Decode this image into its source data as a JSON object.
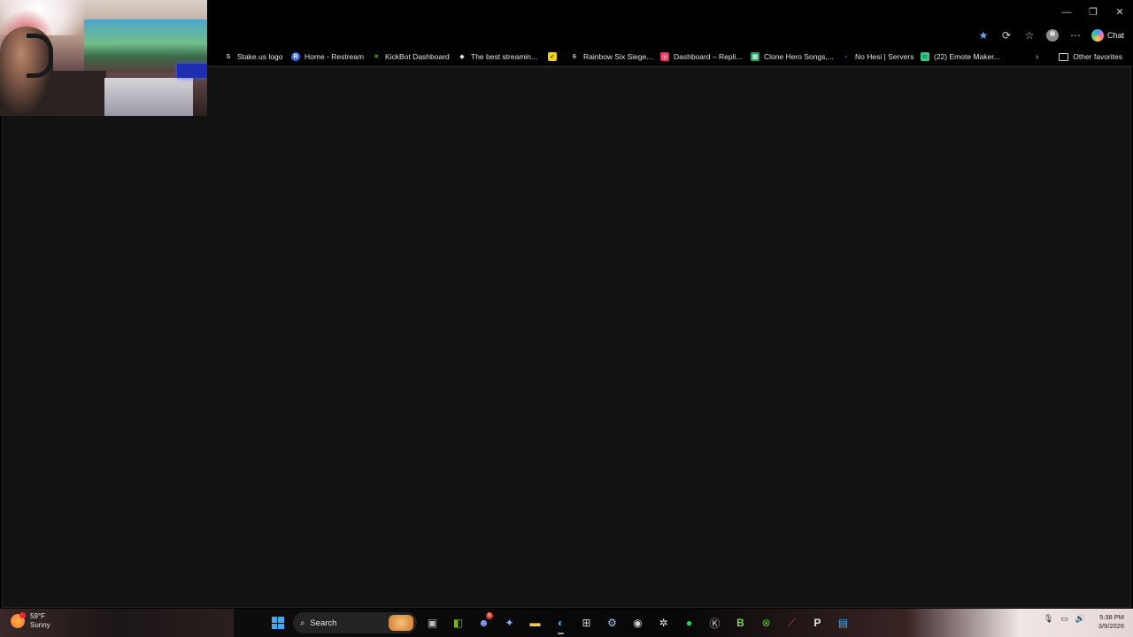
{
  "window": {
    "controls": {
      "minimize": "—",
      "restore": "❐",
      "close": "✕"
    }
  },
  "toolbar": {
    "favorite_star_icon": "star-icon",
    "extensions_icon": "extensions-icon",
    "favorites_icon": "favorites-icon",
    "profile_icon": "profile-icon",
    "more_icon": "more-icon",
    "chat_label": "Chat"
  },
  "favorites_bar": {
    "items": [
      {
        "label": "Stake.us logo",
        "icon": "S",
        "color": "#cfcfcf"
      },
      {
        "label": "Home - Restream",
        "icon": "R",
        "color": "#3b6ee8"
      },
      {
        "label": "KickBot Dashboard",
        "icon": "✕",
        "color": "#53fc18"
      },
      {
        "label": "The best streamin...",
        "icon": "◆",
        "color": "#e6e6e6"
      },
      {
        "label": "",
        "icon": "✓",
        "color": "#f5d20a"
      },
      {
        "label": "Rainbow Six Siege...",
        "icon": "6",
        "color": "#cfcfcf"
      },
      {
        "label": "Dashboard – Repli...",
        "icon": "◎",
        "color": "#e8345a"
      },
      {
        "label": "Clone Hero Songs,...",
        "icon": "▦",
        "color": "#1fa463"
      },
      {
        "label": "No Hesi | Servers",
        "icon": "◗",
        "color": "#7b3fe4"
      },
      {
        "label": "(22) Emote Maker...",
        "icon": "☺",
        "color": "#33c48b"
      }
    ],
    "more_icon": "chevron-right-icon",
    "other_favorites": "Other favorites"
  },
  "taskbar": {
    "weather": {
      "temp": "59°F",
      "condition": "Sunny"
    },
    "search_label": "Search",
    "discord_badge": "6",
    "clock": {
      "time": "5:38 PM",
      "date": "3/9/2026"
    },
    "apps": [
      "task-view",
      "nvidia",
      "discord",
      "copilot",
      "file-explorer",
      "edge",
      "microsoft-store",
      "steam",
      "obs",
      "steelseries",
      "spotify",
      "4k-video",
      "b-app",
      "xbox",
      "msi-afterburner",
      "p-app",
      "notepad"
    ]
  }
}
